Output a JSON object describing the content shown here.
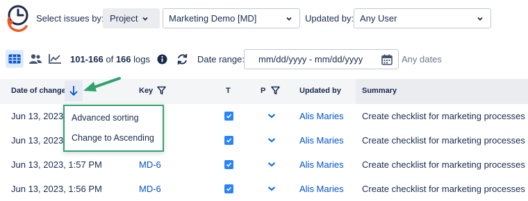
{
  "filters": {
    "select_issues_label": "Select issues by:",
    "project_button": "Project",
    "project_value": "Marketing Demo [MD]",
    "updated_by_label": "Updated by:",
    "updated_by_value": "Any User"
  },
  "toolbar": {
    "count_range": "101-166",
    "count_of": "of",
    "count_total": "166",
    "count_suffix": "logs",
    "date_range_label": "Date range:",
    "date_placeholder": "mm/dd/yyyy - mm/dd/yyyy",
    "any_dates": "Any dates"
  },
  "table": {
    "headers": {
      "date": "Date of change",
      "key": "Key",
      "t": "T",
      "p": "P",
      "updated_by": "Updated by",
      "summary": "Summary"
    },
    "rows": [
      {
        "date": "Jun 13, 2023,",
        "key": "",
        "updated_by": "Alis Maries",
        "summary": "Create checklist for marketing processes"
      },
      {
        "date": "Jun 13, 2023,",
        "key": "",
        "updated_by": "Alis Maries",
        "summary": "Create checklist for marketing processes"
      },
      {
        "date": "Jun 13, 2023, 1:57 PM",
        "key": "MD-6",
        "updated_by": "Alis Maries",
        "summary": "Create checklist for marketing processes"
      },
      {
        "date": "Jun 13, 2023, 1:56 PM",
        "key": "MD-6",
        "updated_by": "Alis Maries",
        "summary": "Create checklist for marketing processes"
      }
    ]
  },
  "sort_menu": {
    "items": [
      "Advanced sorting",
      "Change to Ascending"
    ]
  },
  "colors": {
    "accent": "#0052cc",
    "checkbox": "#2684ff",
    "highlight": "#2fa36b",
    "logo_orange": "#f15a24",
    "logo_navy": "#1e2a4a"
  }
}
